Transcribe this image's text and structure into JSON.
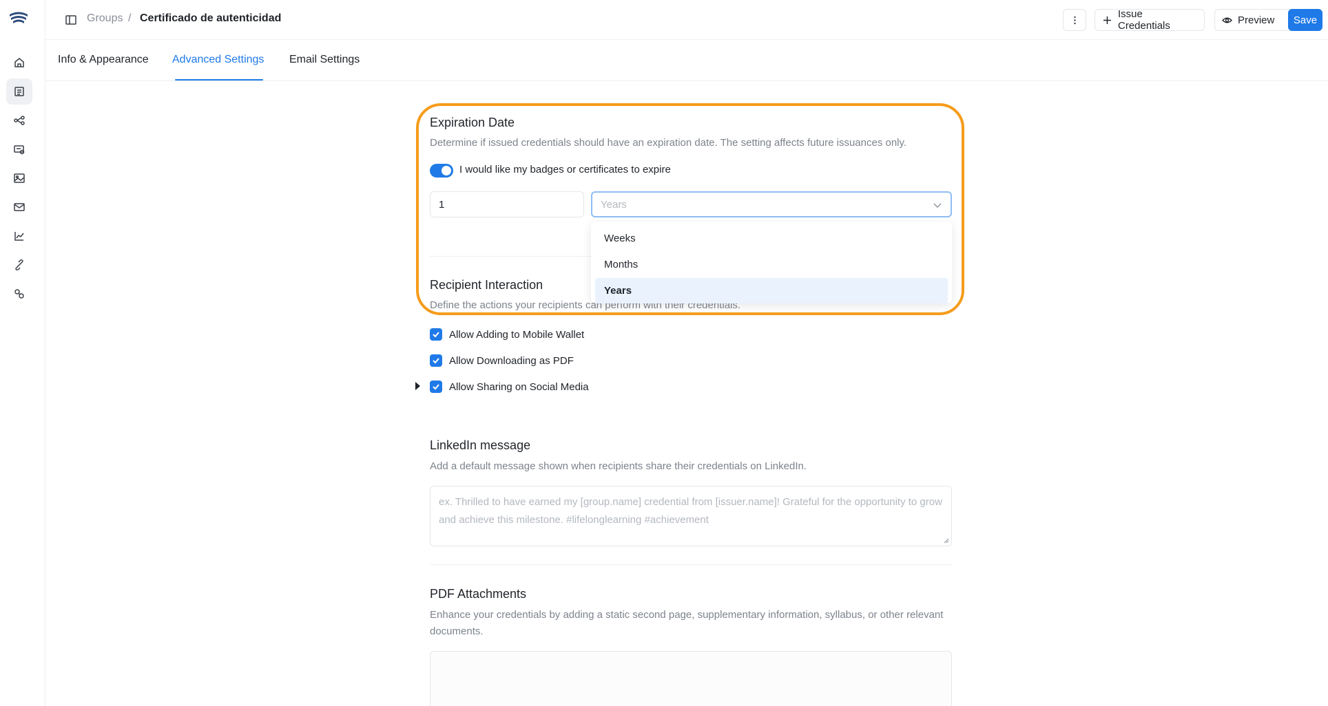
{
  "breadcrumb": {
    "groups": "Groups",
    "separator": "/",
    "current": "Certificado de autenticidad"
  },
  "header": {
    "issue_label": "Issue Credentials",
    "preview_label": "Preview",
    "save_label": "Save"
  },
  "tabs": [
    {
      "label": "Info & Appearance",
      "active": false
    },
    {
      "label": "Advanced Settings",
      "active": true
    },
    {
      "label": "Email Settings",
      "active": false
    }
  ],
  "sidebar": {
    "items": [
      "home-icon",
      "credentials-icon",
      "workflow-icon",
      "designs-icon",
      "gallery-icon",
      "mail-icon",
      "analytics-icon",
      "integrations-icon",
      "settings-icon"
    ],
    "active_index": 1
  },
  "expiration": {
    "title": "Expiration Date",
    "desc": "Determine if issued credentials should have an expiration date. The setting affects future issuances only.",
    "toggle_label": "I would like my badges or certificates to expire",
    "toggle_on": true,
    "amount": "1",
    "unit": "Years",
    "options": [
      "Weeks",
      "Months",
      "Years"
    ],
    "selected_option": "Years"
  },
  "recipient": {
    "title": "Recipient Interaction",
    "desc": "Define the actions your recipients can perform with their credentials.",
    "options": [
      {
        "label": "Allow Adding to Mobile Wallet",
        "checked": true
      },
      {
        "label": "Allow Downloading as PDF",
        "checked": true
      },
      {
        "label": "Allow Sharing on Social Media",
        "checked": true
      }
    ]
  },
  "linkedin": {
    "title": "LinkedIn message",
    "desc": "Add a default message shown when recipients share their credentials on LinkedIn.",
    "placeholder": "ex. Thrilled to have earned my [group.name] credential from [issuer.name]! Grateful for the opportunity to grow and achieve this milestone. #lifelonglearning #achievement"
  },
  "pdf": {
    "title": "PDF Attachments",
    "desc": "Enhance your credentials by adding a static second page, supplementary information, syllabus, or other relevant documents."
  },
  "colors": {
    "accent": "#1f7ae8",
    "highlight": "#f59c1b"
  }
}
